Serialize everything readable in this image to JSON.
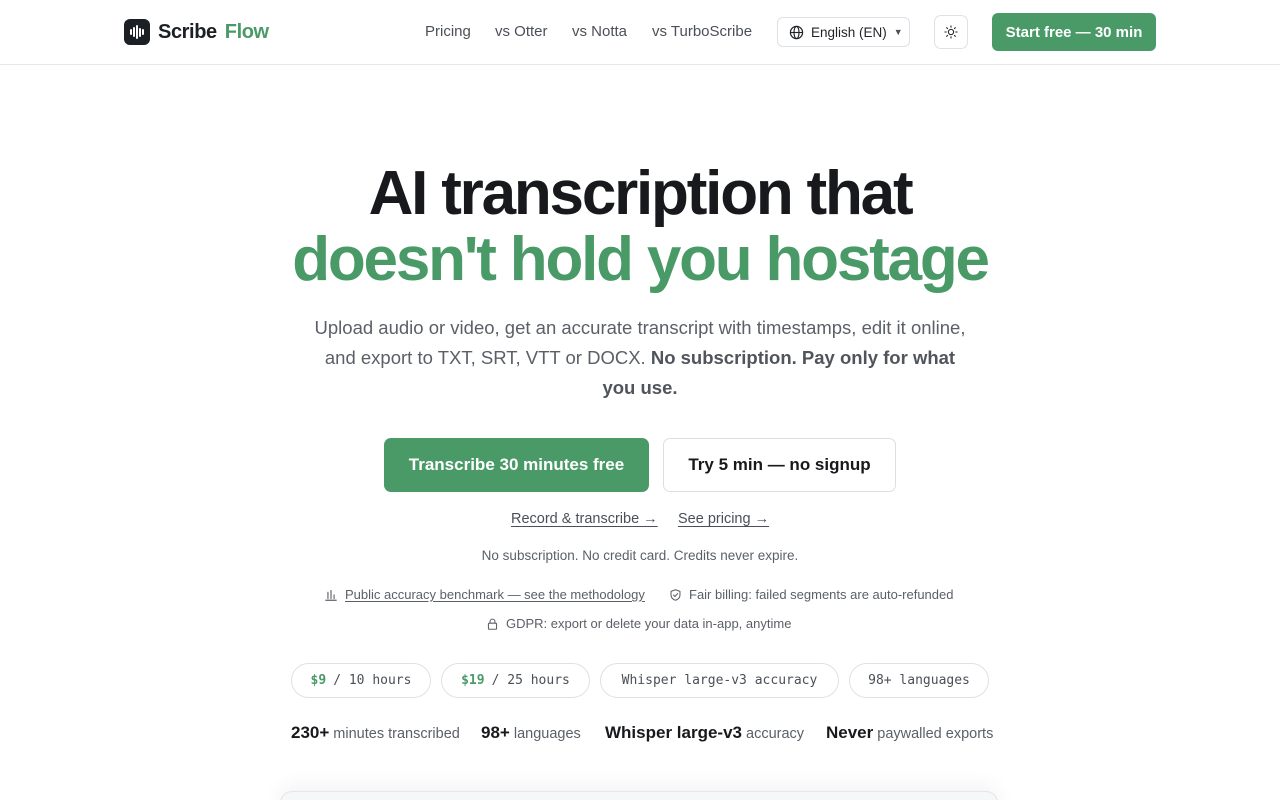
{
  "brand": {
    "name_part1": "Scribe",
    "name_part2": "Flow",
    "logo_icon": "waveform-icon"
  },
  "nav": {
    "links": [
      "Pricing",
      "vs Otter",
      "vs Notta",
      "vs TurboScribe"
    ],
    "language": "English (EN)",
    "theme_icon": "sun-icon",
    "cta": "Start free — 30 min"
  },
  "hero": {
    "title_line1": "AI transcription that",
    "title_line2": "doesn't hold you hostage",
    "subtitle": "Upload audio or video, get an accurate transcript with timestamps, edit it online, and export to TXT, SRT, VTT or DOCX.",
    "subtitle_bold": "No subscription. Pay only for what you use.",
    "primary_button": "Transcribe 30 minutes free",
    "secondary_button": "Try 5 min — no signup",
    "link_record": "Record & transcribe →",
    "link_pricing": "See pricing →",
    "note": "No subscription. No credit card. Credits never expire."
  },
  "trust": {
    "benchmark": "Public accuracy benchmark — see the methodology",
    "billing": "Fair billing: failed segments are auto-refunded",
    "gdpr": "GDPR: export or delete your data in-app, anytime"
  },
  "pills": {
    "p1_price": "$9",
    "p1_rest": "/ 10 hours",
    "p2_price": "$19",
    "p2_rest": "/ 25 hours",
    "p3": "Whisper large-v3 accuracy",
    "p4": "98+ languages"
  },
  "stats": [
    {
      "value": "230+",
      "label": "minutes transcribed"
    },
    {
      "value": "98+",
      "label": "languages"
    },
    {
      "value": "Whisper large-v3",
      "label": "accuracy"
    },
    {
      "value": "Never",
      "label": "paywalled exports"
    }
  ],
  "colors": {
    "accent": "#4a9a68",
    "text": "#17191c",
    "muted": "#5b6068"
  }
}
